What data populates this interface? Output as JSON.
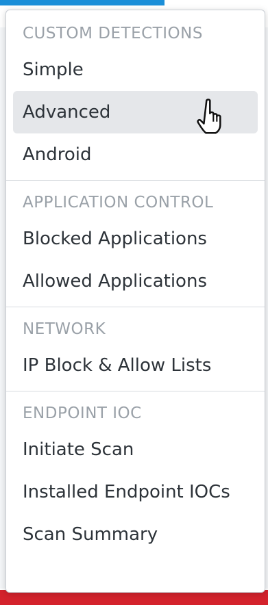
{
  "menu": {
    "sections": [
      {
        "header": "CUSTOM DETECTIONS",
        "items": [
          "Simple",
          "Advanced",
          "Android"
        ]
      },
      {
        "header": "APPLICATION CONTROL",
        "items": [
          "Blocked Applications",
          "Allowed Applications"
        ]
      },
      {
        "header": "NETWORK",
        "items": [
          "IP Block & Allow Lists"
        ]
      },
      {
        "header": "ENDPOINT IOC",
        "items": [
          "Initiate Scan",
          "Installed Endpoint IOCs",
          "Scan Summary"
        ]
      }
    ],
    "hovered_item": "Advanced"
  },
  "colors": {
    "header_text": "#9aa1a8",
    "item_text": "#2d3339",
    "hover_bg": "#e5e7ea",
    "accent_blue": "#1a8ed8",
    "accent_red": "#d4222c"
  },
  "icons": {
    "cursor": "hand-pointer-icon"
  }
}
